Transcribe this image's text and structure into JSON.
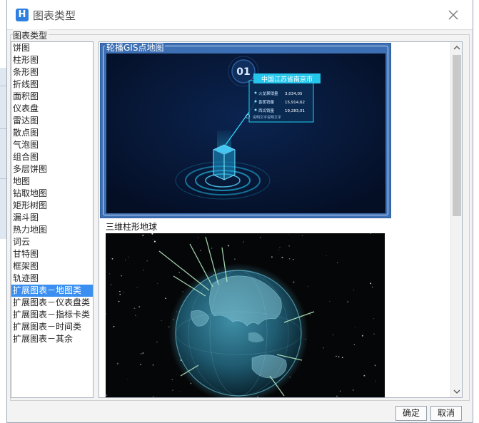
{
  "window": {
    "title": "图表类型",
    "logo_letter": "H"
  },
  "group_label": "图表类型",
  "chart_types": [
    "饼图",
    "柱形图",
    "条形图",
    "折线图",
    "面积图",
    "仪表盘",
    "雷达图",
    "散点图",
    "气泡图",
    "组合图",
    "多层饼图",
    "地图",
    "钻取地图",
    "矩形树图",
    "漏斗图",
    "热力地图",
    "词云",
    "甘特图",
    "框架图",
    "轨迹图",
    "扩展图表－地图类",
    "扩展图表－仪表盘类",
    "扩展图表－指标卡类",
    "扩展图表－时间类",
    "扩展图表－其余"
  ],
  "selected_type": "扩展图表－地图类",
  "previews": [
    {
      "label": "轮播GIS点地图",
      "selected": true,
      "info_card": {
        "number": "01",
        "title": "中国江苏省南京市",
        "rows": [
          {
            "label": "火龙果销量",
            "value": "3,034,05"
          },
          {
            "label": "香蕉销量",
            "value": "15,914,62"
          },
          {
            "label": "西瓜销量",
            "value": "19,283,01"
          }
        ],
        "footnote": "说明文字说明文字"
      }
    },
    {
      "label": "三维柱形地球",
      "selected": false
    }
  ],
  "buttons": {
    "ok": "确定",
    "cancel": "取消"
  },
  "colors": {
    "selection": "#3b8ff0",
    "card_selected": "#3c6fb4",
    "map_bg": "#061533",
    "globe_bg": "#050607",
    "accent_cyan": "#1fd0ee"
  }
}
